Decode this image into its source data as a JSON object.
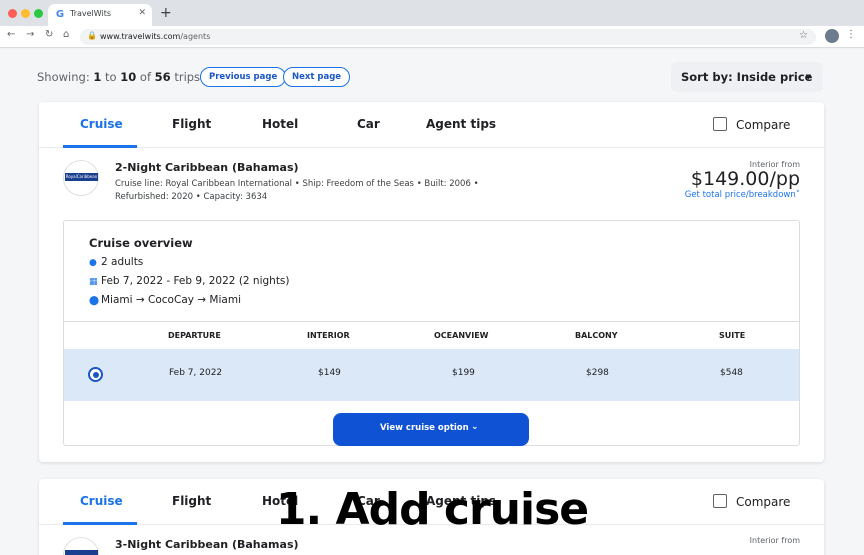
{
  "browser": {
    "tab_title": "TravelWits",
    "tab_favicon": "G",
    "url_host": "www.travelwits.com",
    "url_path": "/agents"
  },
  "toolbar": {
    "showing_prefix": "Showing:",
    "range_start": "1",
    "range_to": "to",
    "range_end": "10",
    "range_of": "of",
    "total": "56",
    "unit": "trips",
    "prev_label": "Previous page",
    "next_label": "Next page",
    "sort_label": "Sort by: Inside price"
  },
  "product_tabs": [
    "Cruise",
    "Flight",
    "Hotel",
    "Car",
    "Agent tips"
  ],
  "compare_label": "Compare",
  "trip": {
    "logo_text": "RoyalCaribbean",
    "title": "2-Night Caribbean (Bahamas)",
    "meta": "Cruise line: Royal Caribbean International • Ship: Freedom of the Seas • Built: 2006 • Refurbished: 2020 • Capacity: 3634",
    "price_label": "Interior from",
    "price": "$149.00/pp",
    "breakdown_link": "Get total price/breakdown˅"
  },
  "overview": {
    "title": "Cruise overview",
    "guests": "2 adults",
    "dates": "Feb 7, 2022 - Feb 9, 2022 (2 nights)",
    "route": "Miami → CocoCay → Miami",
    "columns": [
      "DEPARTURE",
      "INTERIOR",
      "OCEANVIEW",
      "BALCONY",
      "SUITE"
    ],
    "rows": [
      {
        "selected": true,
        "cells": [
          "Feb 7, 2022",
          "$149",
          "$199",
          "$298",
          "$548"
        ]
      }
    ]
  },
  "view_button": "View cruise option",
  "trip2": {
    "title": "3-Night Caribbean (Bahamas)",
    "price_label": "Interior from"
  },
  "overlay_caption": "1. Add cruise",
  "icons": {
    "guests": "person-icon",
    "dates": "calendar-icon",
    "route": "location-pin-icon"
  },
  "colors": {
    "accent": "#1a73e8",
    "button": "#1052d4",
    "selected_row": "#dbe8f8"
  }
}
